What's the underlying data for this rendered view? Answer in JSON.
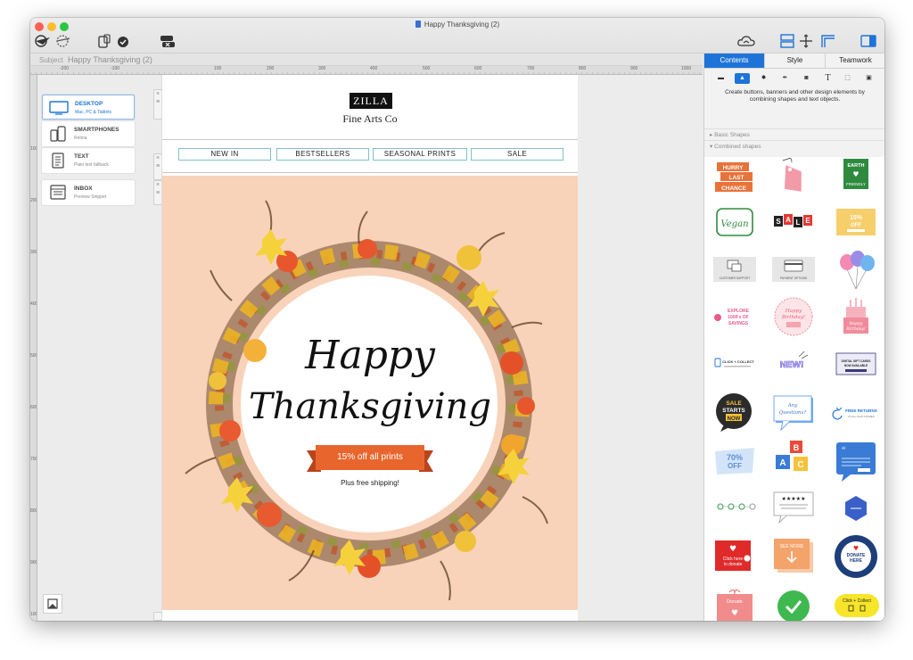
{
  "window": {
    "title": "Happy Thanksgiving (2)",
    "traffic_lights": [
      "#ff5f57",
      "#febc2e",
      "#28c840"
    ]
  },
  "subject": {
    "label": "Subject",
    "value": "Happy Thanksgiving (2)"
  },
  "ruler": {
    "horizontal": [
      "-200",
      "-100",
      "100",
      "200",
      "300",
      "400",
      "500",
      "600",
      "700",
      "800",
      "900",
      "1000"
    ],
    "vertical": [
      "100",
      "200",
      "300",
      "400",
      "500",
      "600",
      "700",
      "800",
      "900",
      "1000"
    ]
  },
  "device_cards": [
    {
      "title": "DESKTOP",
      "subtitle": "Mac, PC & Tablets",
      "icon": "monitor-icon",
      "active": true
    },
    {
      "title": "SMARTPHONES",
      "subtitle": "Retina",
      "icon": "phone-icon",
      "active": false
    },
    {
      "title": "TEXT",
      "subtitle": "Plain text fallback",
      "icon": "text-doc-icon",
      "active": false
    },
    {
      "title": "INBOX",
      "subtitle": "Preview Snippet",
      "icon": "inbox-icon",
      "active": false
    }
  ],
  "email": {
    "logo": "ZILLA",
    "tagline": "Fine Arts Co",
    "nav": [
      "NEW IN",
      "BESTSELLERS",
      "SEASONAL PRINTS",
      "SALE"
    ],
    "hero": {
      "line1": "Happy",
      "line2": "Thanksgiving",
      "ribbon": "15% off all prints",
      "subline": "Plus free shipping!"
    }
  },
  "panel": {
    "tabs": [
      "Contents",
      "Style",
      "Teamwork"
    ],
    "active_tab": "Contents",
    "tool_icons": [
      "box-icon",
      "shape-icon",
      "badge-icon",
      "pen-icon",
      "camera-icon",
      "text-tool-icon",
      "dashed-box-icon",
      "image-icon"
    ],
    "text_tool_glyph": "T",
    "description": "Create buttons, banners and other design elements by combining shapes and text objects.",
    "sections": [
      "Basic Shapes",
      "Combined shapes"
    ],
    "shape_items": [
      {
        "name": "hurry-last-chance",
        "texts": [
          "HURRY",
          "LAST",
          "CHANCE"
        ]
      },
      {
        "name": "price-tag",
        "texts": []
      },
      {
        "name": "earth-friendly",
        "texts": [
          "EARTH",
          "FRIENDLY"
        ]
      },
      {
        "name": "vegan",
        "texts": [
          "Vegan"
        ]
      },
      {
        "name": "sale-blocks",
        "texts": [
          "S",
          "A",
          "L",
          "E"
        ]
      },
      {
        "name": "percent-off",
        "texts": [
          "15%",
          "OFF"
        ]
      },
      {
        "name": "customer-support",
        "texts": [
          "CUSTOMER SUPPORT"
        ]
      },
      {
        "name": "payment-options",
        "texts": [
          "PAYMENT OPTIONS"
        ]
      },
      {
        "name": "balloons",
        "texts": []
      },
      {
        "name": "explore-savings",
        "texts": [
          "EXPLORE",
          "1000's OF",
          "SAVINGS"
        ]
      },
      {
        "name": "happy-birthday-badge",
        "texts": [
          "Happy",
          "Birthday!"
        ]
      },
      {
        "name": "birthday-cake",
        "texts": [
          "Happy",
          "Birthday!"
        ]
      },
      {
        "name": "click-collect",
        "texts": [
          "CLICK + COLLECT"
        ]
      },
      {
        "name": "new-badge",
        "texts": [
          "NEW!"
        ]
      },
      {
        "name": "gift-card",
        "texts": [
          "DIGITAL GIFT CARDS",
          "NOW AVAILABLE"
        ]
      },
      {
        "name": "sale-starts-now",
        "texts": [
          "SALE",
          "STARTS",
          "NOW"
        ]
      },
      {
        "name": "any-questions",
        "texts": [
          "Any",
          "Questions?"
        ]
      },
      {
        "name": "free-returns",
        "texts": [
          "FREE RETURNS",
          "IN ALL OUR STORES"
        ]
      },
      {
        "name": "seventy-off",
        "texts": [
          "70%",
          "OFF"
        ]
      },
      {
        "name": "abc-blocks",
        "texts": [
          "A",
          "B",
          "C"
        ]
      },
      {
        "name": "quote-bubble",
        "texts": [
          "“"
        ]
      },
      {
        "name": "progress-steps",
        "texts": []
      },
      {
        "name": "review-stars",
        "texts": [
          "★★★★★"
        ]
      },
      {
        "name": "hexagon-badge",
        "texts": []
      },
      {
        "name": "click-donate",
        "texts": [
          "Click here",
          "to donate"
        ]
      },
      {
        "name": "see-more",
        "texts": [
          "SEE MORE"
        ]
      },
      {
        "name": "donate-here",
        "texts": [
          "DONATE",
          "HERE"
        ]
      },
      {
        "name": "donate-gift",
        "texts": [
          "Donate"
        ]
      },
      {
        "name": "check-circle",
        "texts": []
      },
      {
        "name": "click-collect-pill",
        "texts": [
          "Click + Collect"
        ]
      }
    ]
  },
  "colors": {
    "accent": "#1e73d9",
    "hero_bg": "#f8d3ba",
    "ribbon": "#e8662e",
    "nav_border": "#7fc0c6"
  }
}
